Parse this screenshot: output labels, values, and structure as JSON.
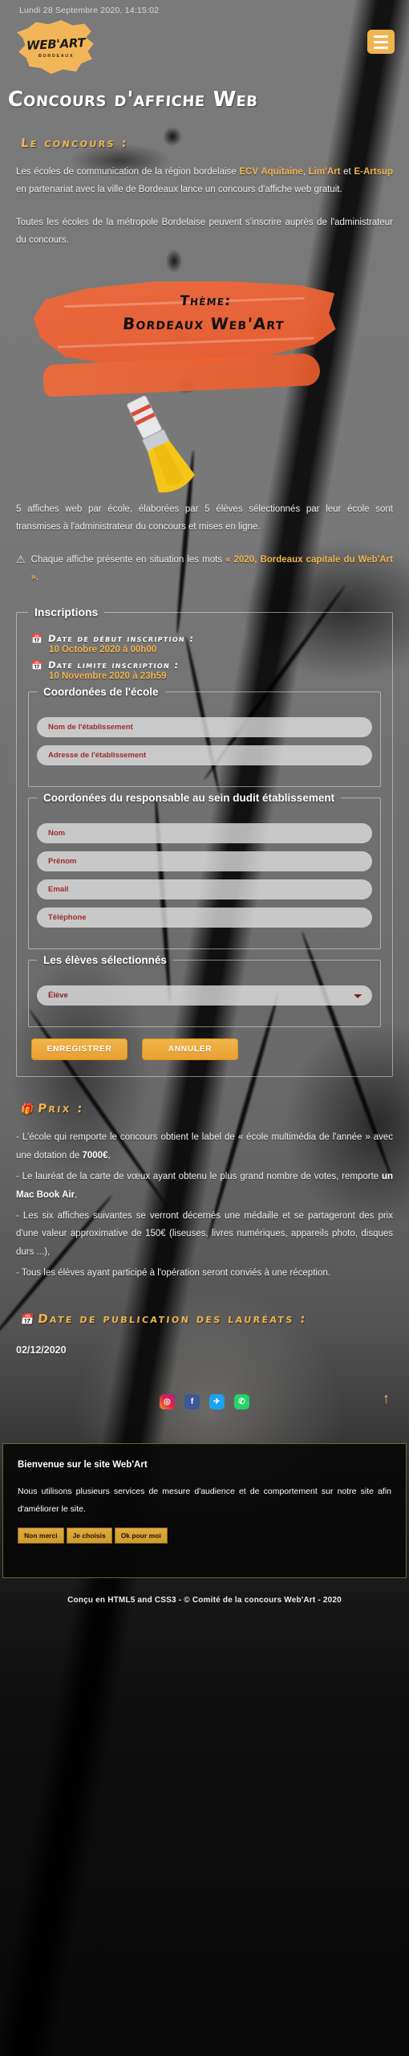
{
  "header": {
    "clock": "Lundi 28 Septembre 2020, 14:15:02",
    "logo_main": "WEB'ART",
    "logo_sub": "BORDEAUX",
    "menu_icon": "hamburger-menu-icon"
  },
  "page_title": "Concours d'affiche Web",
  "concours": {
    "heading": "Le concours :",
    "p1_a": "Les écoles de communication de la région bordelaise ",
    "p1_link1": "ECV Aquitaine",
    "p1_b": ", ",
    "p1_link2": "Lim'Art",
    "p1_c": " et ",
    "p1_link3": "E-Artsup",
    "p1_d": " en partenariat avec la ville de Bordeaux lance un concours d'affiche web gratuit.",
    "p2": "Toutes les écoles de la métropole Bordelaise peuvent s'inscrire auprès de l'administrateur du concours.",
    "p3": "5 affiches web par école, élaborées par 5 élèves sélectionnés par leur école sont transmises à l'administrateur du concours et mises en ligne.",
    "warn_icon": "warning-triangle-icon",
    "warn_a": "Chaque affiche présente en situation les mots ",
    "warn_hl": "« 2020, Bordeaux capitale du Web'Art »",
    "warn_b": "."
  },
  "theme_banner": {
    "line1": "Thème:",
    "line2": "Bordeaux Web'Art",
    "image": "paintbrush-illustration"
  },
  "inscriptions": {
    "legend": "Inscriptions",
    "calendar_icon": "calendar-icon",
    "start_label": "Date de début inscription :",
    "start_value": "10 Octobre 2020 à 00h00",
    "end_label": "Date limite inscription :",
    "end_value": "10 Novembre 2020 à 23h59",
    "school": {
      "legend": "Coordonées de l'école",
      "fields": [
        {
          "name": "nom-etablissement",
          "placeholder": "Nom de l'établissement",
          "value": ""
        },
        {
          "name": "adresse-etablissement",
          "placeholder": "Adresse de l'établissement",
          "value": ""
        }
      ]
    },
    "manager": {
      "legend": "Coordonées du responsable au sein dudit établissement",
      "fields": [
        {
          "name": "nom",
          "placeholder": "Nom",
          "value": ""
        },
        {
          "name": "prenom",
          "placeholder": "Prénom",
          "value": ""
        },
        {
          "name": "email",
          "placeholder": "Email",
          "value": ""
        },
        {
          "name": "telephone",
          "placeholder": "Téléphone",
          "value": ""
        }
      ]
    },
    "students": {
      "legend": "Les élèves sélectionnés",
      "select_label": "Élève",
      "options": [
        "Élève"
      ]
    },
    "save_label": "ENREGISTRER",
    "cancel_label": "ANNULER"
  },
  "prix": {
    "icon": "gift-icon",
    "heading": "Prix :",
    "l1_a": "- L'école qui remporte le concours obtient le label de « école multimédia de l'année » avec une dotation de ",
    "l1_b": "7000€",
    "l1_c": ",",
    "l2_a": "- Le lauréat de la carte de vœux ayant obtenu le plus grand nombre de votes, remporte ",
    "l2_b": "un Mac Book Air",
    "l2_c": ",",
    "l3": "- Les six affiches suivantes se verront décernés une médaille et se partageront des prix d'une valeur approximative de 150€ (liseuses, livres numériques, appareils photo, disques durs ...),",
    "l4": "- Tous les élèves ayant participé à l'opération seront conviés à une réception."
  },
  "publication": {
    "icon": "calendar-icon",
    "heading": "Date de publication des lauréats :",
    "value": "02/12/2020"
  },
  "social": {
    "back_to_top_icon": "arrow-up-icon",
    "items": [
      {
        "name": "instagram",
        "glyph": "◎"
      },
      {
        "name": "facebook",
        "glyph": "f"
      },
      {
        "name": "twitter",
        "glyph": "✈"
      },
      {
        "name": "whatsapp",
        "glyph": "✆"
      }
    ]
  },
  "cookie": {
    "title": "Bienvenue sur le site Web'Art",
    "text": "Nous utilisons plusieurs services de mesure d'audience et de comportement sur notre site afin d'améliorer le site.",
    "buttons": [
      "Non merci",
      "Je choisis",
      "Ok pour moi"
    ]
  },
  "footer": "Conçu en HTML5 and CSS3 - © Comité de la concours Web'Art - 2020",
  "colors": {
    "accent": "#f0b44f",
    "brush": "#ee6235",
    "placeholder": "#9e2b2b",
    "bg": "#7a7a7a"
  }
}
